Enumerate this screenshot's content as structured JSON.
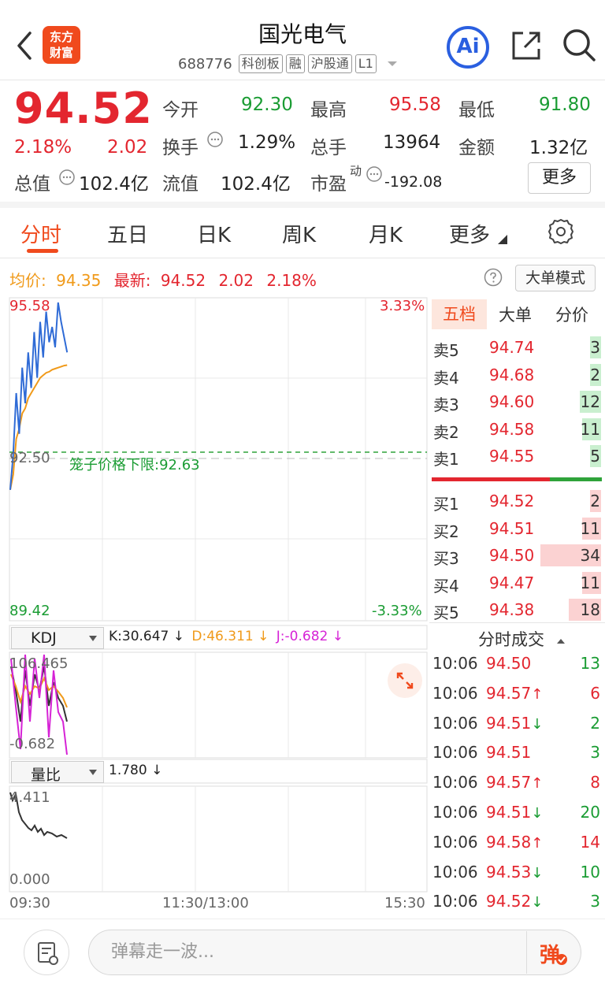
{
  "header": {
    "logo_line1": "东方",
    "logo_line2": "财富",
    "title": "国光电气",
    "code": "688776",
    "tags": [
      "科创板",
      "融",
      "沪股通",
      "L1"
    ],
    "ai_label": "Ai"
  },
  "quote": {
    "price": "94.52",
    "change_pct": "2.18%",
    "change": "2.02",
    "total_value_label": "总值",
    "total_value": "102.4亿",
    "open_label": "今开",
    "open": "92.30",
    "high_label": "最高",
    "high": "95.58",
    "low_label": "最低",
    "low": "91.80",
    "turnover_label": "换手",
    "turnover": "1.29%",
    "volume_label": "总手",
    "volume": "13964",
    "amount_label": "金额",
    "amount": "1.32亿",
    "float_label": "流值",
    "float_value": "102.4亿",
    "pe_label": "市盈",
    "pe_sup": "动",
    "pe": "-192.08",
    "more_label": "更多"
  },
  "tabs": [
    "分时",
    "五日",
    "日K",
    "周K",
    "月K",
    "更多"
  ],
  "info": {
    "avg_label": "均价:",
    "avg": "94.35",
    "last_label": "最新:",
    "last": "94.52",
    "chg": "2.02",
    "chg_pct": "2.18%",
    "bigorder_label": "大单模式"
  },
  "chart": {
    "price_top": "95.58",
    "price_mid": "92.50",
    "price_bottom": "89.42",
    "pct_top": "3.33%",
    "pct_bottom": "-3.33%",
    "limit_text": "笼子价格下限:92.63",
    "kdj_label": "KDJ",
    "kdj_k": "K:30.647 ↓",
    "kdj_d": "D:46.311 ↓",
    "kdj_j": "J:-0.682 ↓",
    "kdj_top": "106.465",
    "kdj_bottom": "-0.682",
    "vr_label": "量比",
    "vr_value": "1.780 ↓",
    "vr_top": "4.411",
    "vr_bottom": "0.000",
    "time_start": "09:30",
    "time_mid": "11:30/13:00",
    "time_end": "15:30",
    "price_series": [
      91.9,
      92.6,
      93.8,
      93.0,
      94.3,
      93.6,
      94.6,
      93.9,
      95.0,
      94.1,
      95.2,
      94.5,
      95.4,
      94.8,
      95.1,
      94.7,
      95.58,
      95.2,
      94.9,
      94.6
    ],
    "avg_series": [
      91.9,
      92.2,
      92.9,
      93.1,
      93.4,
      93.5,
      93.7,
      93.8,
      93.9,
      94.0,
      94.1,
      94.15,
      94.2,
      94.22,
      94.26,
      94.28,
      94.3,
      94.32,
      94.34,
      94.35
    ]
  },
  "orderbook": {
    "tabs": [
      "五档",
      "大单",
      "分价"
    ],
    "asks": [
      {
        "label": "卖5",
        "price": "94.74",
        "vol": "3",
        "ratio": 0.06
      },
      {
        "label": "卖4",
        "price": "94.68",
        "vol": "2",
        "ratio": 0.04
      },
      {
        "label": "卖3",
        "price": "94.60",
        "vol": "12",
        "ratio": 0.16
      },
      {
        "label": "卖2",
        "price": "94.58",
        "vol": "11",
        "ratio": 0.14
      },
      {
        "label": "卖1",
        "price": "94.55",
        "vol": "5",
        "ratio": 0.08
      }
    ],
    "bids": [
      {
        "label": "买1",
        "price": "94.52",
        "vol": "2",
        "ratio": 0.05
      },
      {
        "label": "买2",
        "price": "94.51",
        "vol": "11",
        "ratio": 0.14
      },
      {
        "label": "买3",
        "price": "94.50",
        "vol": "34",
        "ratio": 0.45
      },
      {
        "label": "买4",
        "price": "94.47",
        "vol": "11",
        "ratio": 0.14
      },
      {
        "label": "买5",
        "price": "94.38",
        "vol": "18",
        "ratio": 0.24
      }
    ]
  },
  "trades": {
    "title": "分时成交",
    "rows": [
      {
        "time": "10:06",
        "price": "94.50",
        "vol": "13",
        "dir": "",
        "vcolor": "green"
      },
      {
        "time": "10:06",
        "price": "94.57",
        "vol": "6",
        "dir": "↑",
        "vcolor": "red"
      },
      {
        "time": "10:06",
        "price": "94.51",
        "vol": "2",
        "dir": "↓",
        "vcolor": "green"
      },
      {
        "time": "10:06",
        "price": "94.51",
        "vol": "3",
        "dir": "",
        "vcolor": "green"
      },
      {
        "time": "10:06",
        "price": "94.57",
        "vol": "8",
        "dir": "↑",
        "vcolor": "red"
      },
      {
        "time": "10:06",
        "price": "94.51",
        "vol": "20",
        "dir": "↓",
        "vcolor": "green"
      },
      {
        "time": "10:06",
        "price": "94.58",
        "vol": "14",
        "dir": "↑",
        "vcolor": "red"
      },
      {
        "time": "10:06",
        "price": "94.53",
        "vol": "10",
        "dir": "↓",
        "vcolor": "green"
      },
      {
        "time": "10:06",
        "price": "94.52",
        "vol": "3",
        "dir": "↓",
        "vcolor": "green"
      }
    ]
  },
  "bottom": {
    "input_placeholder": "弹幕走一波...",
    "danmaku_label": "弹"
  },
  "colors": {
    "red": "#e3262f",
    "green": "#1a9c33",
    "orange": "#f09a1a",
    "blue": "#2f6bd6",
    "magenta": "#d623d6",
    "brand": "#f04a1d"
  }
}
